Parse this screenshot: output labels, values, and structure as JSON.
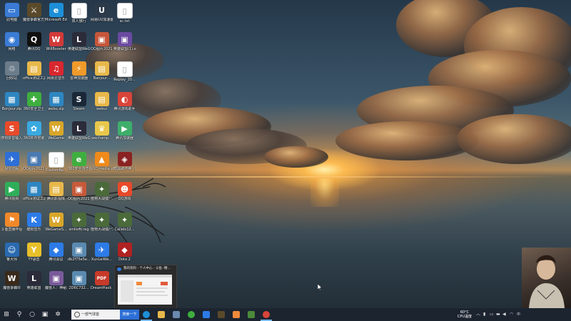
{
  "desktop": {
    "icons": [
      {
        "label": "此电脑",
        "color": "#3a7bd5",
        "glyph": "▭"
      },
      {
        "label": "魔兽争霸官方对战平台",
        "color": "#5a4a2a",
        "glyph": "⚔"
      },
      {
        "label": "Microsoft Edge",
        "color": "#1c8fd8",
        "glyph": "e"
      },
      {
        "label": "双人旅行",
        "color": "#ffffff",
        "glyph": "▯"
      },
      {
        "label": "网易UU加速器",
        "color": "#2d3a4a",
        "glyph": "U"
      },
      {
        "label": "sc.txt",
        "color": "#ffffff",
        "glyph": "▯"
      },
      {
        "label": "网络",
        "color": "#3a7bd5",
        "glyph": "◉"
      },
      {
        "label": "腾讯QQ",
        "color": "#111111",
        "glyph": "Q"
      },
      {
        "label": "WillBooster",
        "color": "#d23a3a",
        "glyph": "W"
      },
      {
        "label": "英雄联盟WeGame版",
        "color": "#2b2b3a",
        "glyph": "L"
      },
      {
        "label": "QQ图片20210621...",
        "color": "#c7563a",
        "glyph": "▣"
      },
      {
        "label": "英雄联盟(1).exe",
        "color": "#6a4aa0",
        "glyph": "▣"
      },
      {
        "label": "回收站",
        "color": "#6c7c8a",
        "glyph": "♲"
      },
      {
        "label": "office测试工具",
        "color": "#e8b84a",
        "glyph": "▤"
      },
      {
        "label": "网易云音乐",
        "color": "#d9272e",
        "glyph": "♫"
      },
      {
        "label": "雷神加速器",
        "color": "#f09a2a",
        "glyph": "⚡"
      },
      {
        "label": "Banjour...",
        "color": "#e8b84a",
        "glyph": "▤"
      },
      {
        "label": "Replay_20...",
        "color": "#ffffff",
        "glyph": "▯"
      },
      {
        "label": "Bonjour.zip",
        "color": "#2e86c1",
        "glyph": "▦"
      },
      {
        "label": "360安全卫士",
        "color": "#3fae3f",
        "glyph": "✚"
      },
      {
        "label": "webu.zip",
        "color": "#2e86c1",
        "glyph": "▦"
      },
      {
        "label": "Steam",
        "color": "#1b2838",
        "glyph": "S"
      },
      {
        "label": "webui",
        "color": "#e8b84a",
        "glyph": "▤"
      },
      {
        "label": "腾讯游戏助手",
        "color": "#d9443a",
        "glyph": "◐"
      },
      {
        "label": "搜狗拼音输入法.exe",
        "color": "#e84a2a",
        "glyph": "S"
      },
      {
        "label": "360软件管家",
        "color": "#3aa9e0",
        "glyph": "✿"
      },
      {
        "label": "WeGame",
        "color": "#d8a62a",
        "glyph": "W"
      },
      {
        "label": "英雄联盟WeGame版",
        "color": "#2b2b3a",
        "glyph": "L"
      },
      {
        "label": "wechamp...",
        "color": "#e8c84a",
        "glyph": "♛"
      },
      {
        "label": "腾讯加速器",
        "color": "#3fae6a",
        "glyph": "▶"
      },
      {
        "label": "极信远程",
        "color": "#2d6fd6",
        "glyph": "✈"
      },
      {
        "label": "QQ图片20210504...",
        "color": "#4a7ab0",
        "glyph": "▣"
      },
      {
        "label": "CustomKe...",
        "color": "#ffffff",
        "glyph": "▯"
      },
      {
        "label": "360安全浏览器",
        "color": "#3fae3f",
        "glyph": "e"
      },
      {
        "label": "VLC media player",
        "color": "#f08a1a",
        "glyph": "▲"
      },
      {
        "label": "暗黑破坏神：魔法...",
        "color": "#8a2222",
        "glyph": "◈"
      },
      {
        "label": "腾讯视频",
        "color": "#2fae5a",
        "glyph": "▶"
      },
      {
        "label": "office测试工具.zip",
        "color": "#2e86c1",
        "glyph": "▦"
      },
      {
        "label": "腾讯影视库",
        "color": "#e8b84a",
        "glyph": "▤"
      },
      {
        "label": "QQ图片20210707...",
        "color": "#c75a3a",
        "glyph": "▣"
      },
      {
        "label": "植物大战僵尸.reg",
        "color": "#4a6a3a",
        "glyph": "✦"
      },
      {
        "label": "QQ游戏",
        "color": "#e84a2a",
        "glyph": "☻"
      },
      {
        "label": "斗鱼直播伴侣",
        "color": "#f0882a",
        "glyph": "⚑"
      },
      {
        "label": "酷狗音乐",
        "color": "#2d7be8",
        "glyph": "K"
      },
      {
        "label": "WeGameS...",
        "color": "#d8a62a",
        "glyph": "W"
      },
      {
        "label": "smile明.reg",
        "color": "#4a6a3a",
        "glyph": "✦"
      },
      {
        "label": "植物大战僵尸2.reg",
        "color": "#4a6a3a",
        "glyph": "✦"
      },
      {
        "label": "Callelo12...",
        "color": "#4a6a3a",
        "glyph": "✦"
      },
      {
        "label": "鲁大师",
        "color": "#2a6ab0",
        "glyph": "☺"
      },
      {
        "label": "YY语音",
        "color": "#e8c02a",
        "glyph": "Y"
      },
      {
        "label": "腾讯会议",
        "color": "#2d7be8",
        "glyph": "◆"
      },
      {
        "label": "db2f75e5e...",
        "color": "#5a8ab0",
        "glyph": "▣"
      },
      {
        "label": "XunLeiWe...",
        "color": "#2d7be8",
        "glyph": "✈"
      },
      {
        "label": "Dota 2",
        "color": "#b02222",
        "glyph": "◆"
      },
      {
        "label": "魔兽争霸III",
        "color": "#3a2a1a",
        "glyph": "W"
      },
      {
        "label": "英雄联盟",
        "color": "#2b2b3a",
        "glyph": "L"
      },
      {
        "label": "魔兽人：神秘海滨",
        "color": "#7a5a9a",
        "glyph": "▣"
      },
      {
        "label": "2D6C732...",
        "color": "#5a8ab0",
        "glyph": "▣"
      },
      {
        "label": "DreamHack WC3 Ope...",
        "color": "#c83a2a",
        "glyph": "PDF"
      }
    ]
  },
  "preview": {
    "title": "我的资料 - 个人中心 - 斗鱼 -精..."
  },
  "taskbar": {
    "start_glyph": "⊞",
    "search_glyph": "⚲",
    "cortana_glyph": "○",
    "taskview_glyph": "▣",
    "widgets_glyph": "✲",
    "search_text": "一部气球首",
    "search_button": "搜索一下",
    "apps": [
      {
        "name": "edge",
        "color": "#1c8fd8"
      },
      {
        "name": "explorer",
        "color": "#e8b84a"
      },
      {
        "name": "store",
        "color": "#6a8ab0"
      },
      {
        "name": "360",
        "color": "#3fae3f"
      },
      {
        "name": "mail",
        "color": "#2d7be8"
      },
      {
        "name": "warcraft",
        "color": "#5a4a2a"
      },
      {
        "name": "app-orange",
        "color": "#f08a3b"
      },
      {
        "name": "app-green",
        "color": "#4a8a3a"
      },
      {
        "name": "chrome",
        "color": "#d9443a"
      }
    ]
  },
  "tray": {
    "temperature": "60°C",
    "cpu_label": "CPU温度",
    "up_arrow": "︿",
    "ime": "中"
  }
}
